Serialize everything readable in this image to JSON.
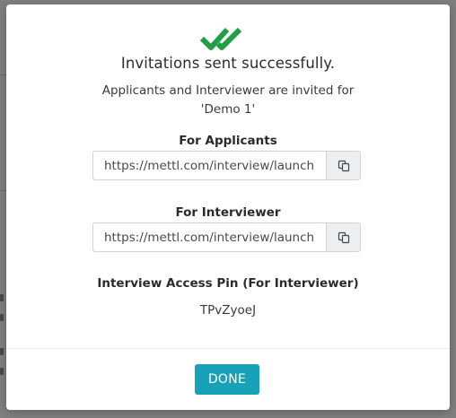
{
  "modal": {
    "title": "Invitations sent successfully.",
    "subtitle": "Applicants and Interviewer are invited for 'Demo 1'",
    "applicants": {
      "label": "For Applicants",
      "link": "https://mettl.com/interview/launch"
    },
    "interviewer": {
      "label": "For Interviewer",
      "link": "https://mettl.com/interview/launch"
    },
    "pin": {
      "label": "Interview Access Pin (For Interviewer)",
      "value": "TPvZyoeJ"
    },
    "done_label": "DONE"
  },
  "icons": {
    "success": "double-check-icon",
    "copy": "copy-icon"
  },
  "colors": {
    "success_green": "#1fa046",
    "accent_teal": "#17a2b8",
    "overlay": "#7f7f7f"
  }
}
